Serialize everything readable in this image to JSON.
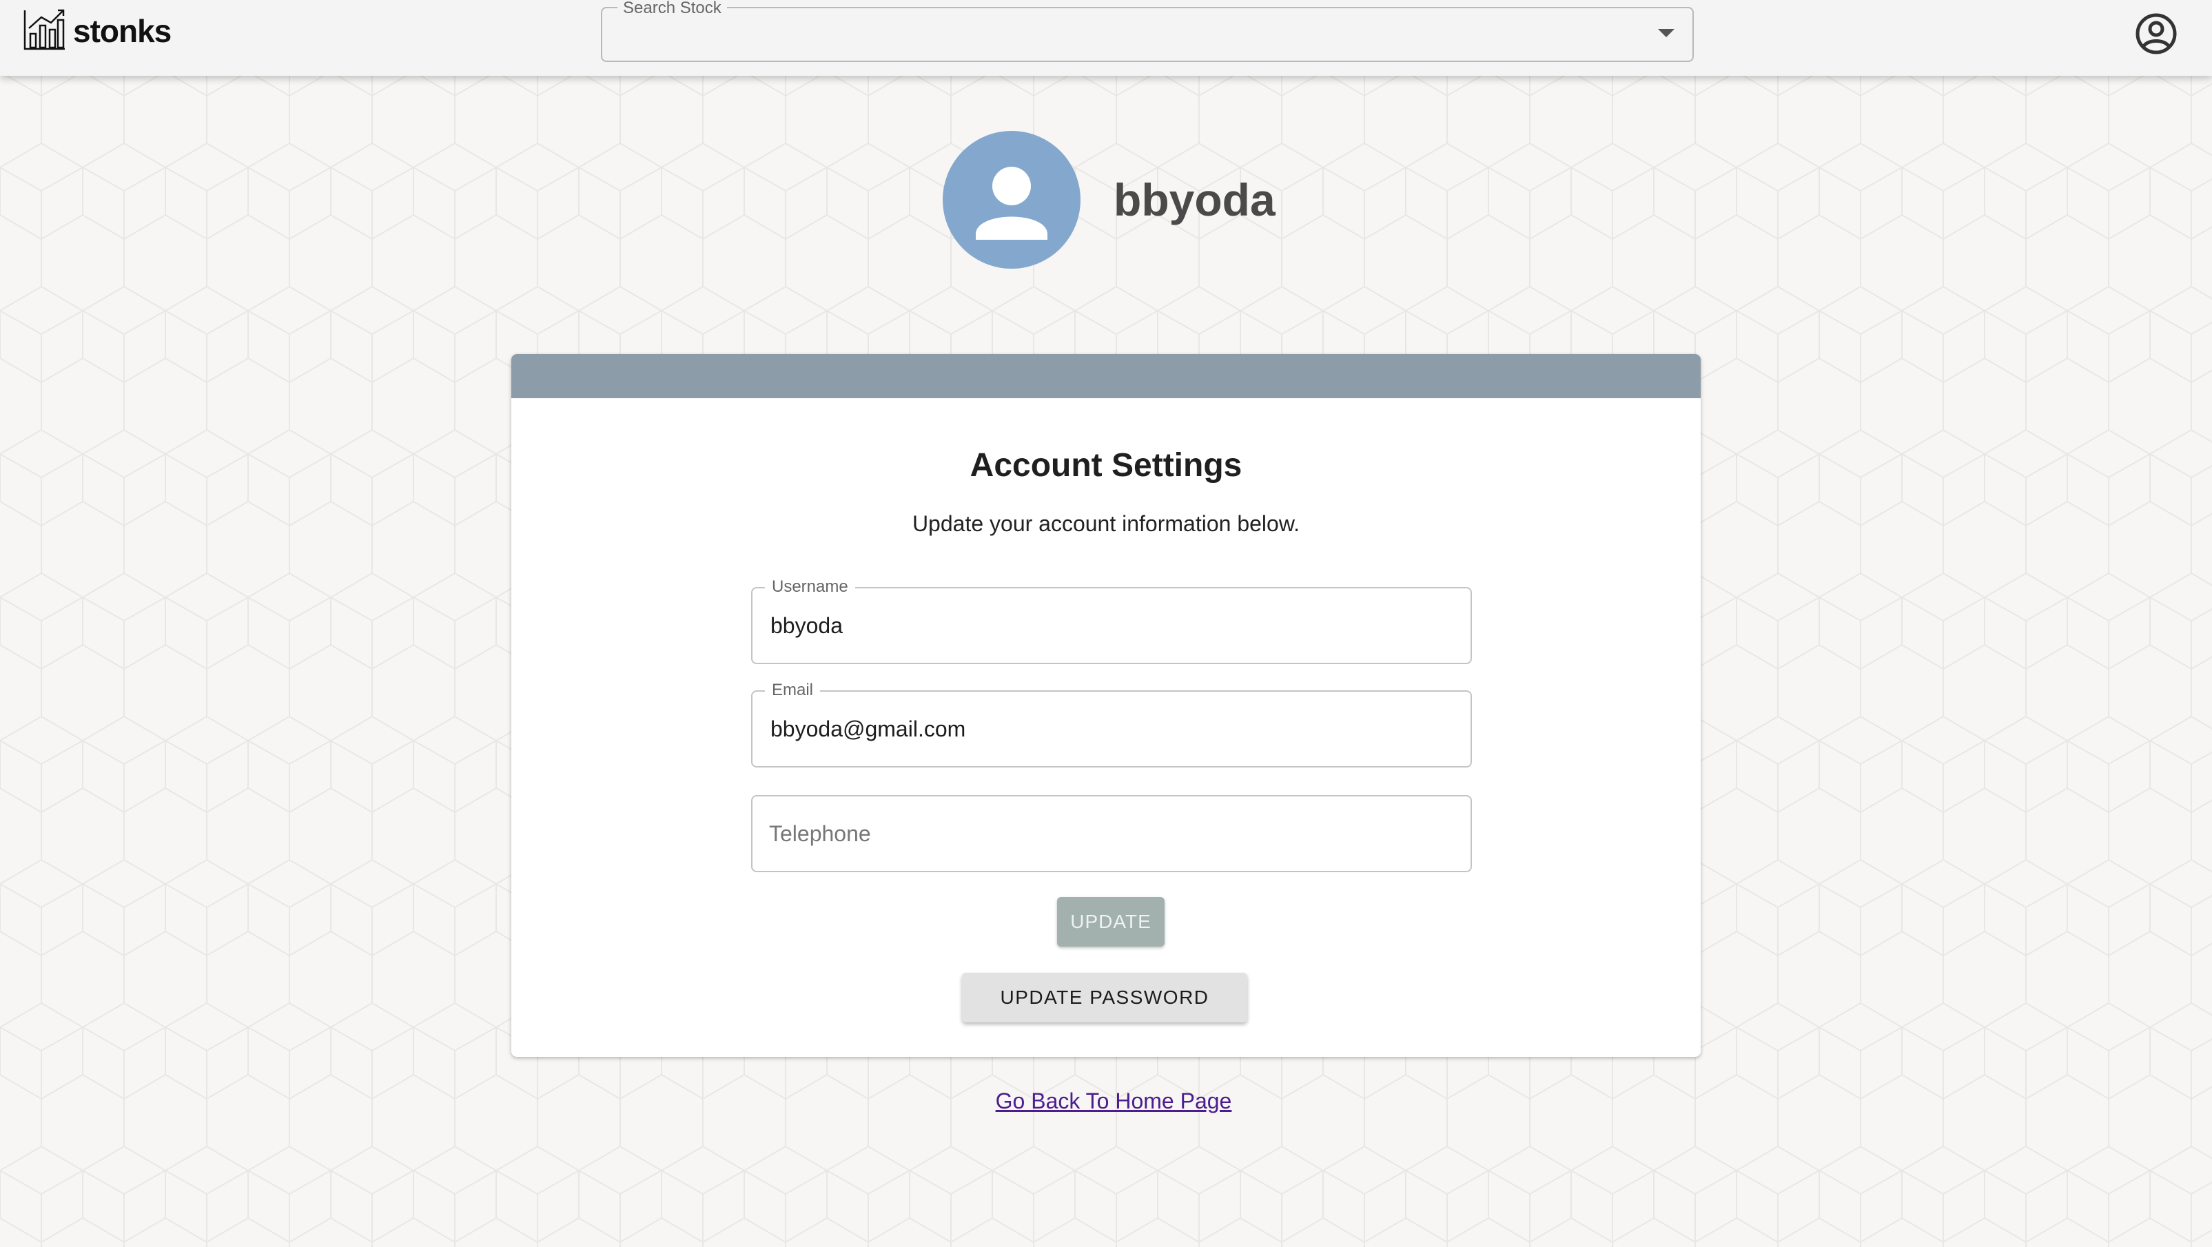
{
  "header": {
    "logo_text": "stonks",
    "search": {
      "label": "Search Stock",
      "value": ""
    },
    "icons": {
      "logo": "bar-chart-logo-icon",
      "caret": "caret-down-icon",
      "account": "account-circle-icon"
    }
  },
  "profile": {
    "username": "bbyoda",
    "avatar_icon": "person-icon",
    "avatar_color": "#84a8cd"
  },
  "card": {
    "header_color": "#8d9ca9",
    "title": "Account Settings",
    "subtitle": "Update your account information below.",
    "fields": {
      "username": {
        "label": "Username",
        "value": "bbyoda"
      },
      "email": {
        "label": "Email",
        "value": "bbyoda@gmail.com"
      },
      "telephone": {
        "placeholder": "Telephone",
        "value": ""
      }
    },
    "update_button": "UPDATE",
    "update_password_button": "UPDATE PASSWORD"
  },
  "footer": {
    "home_link": "Go Back To Home Page"
  }
}
